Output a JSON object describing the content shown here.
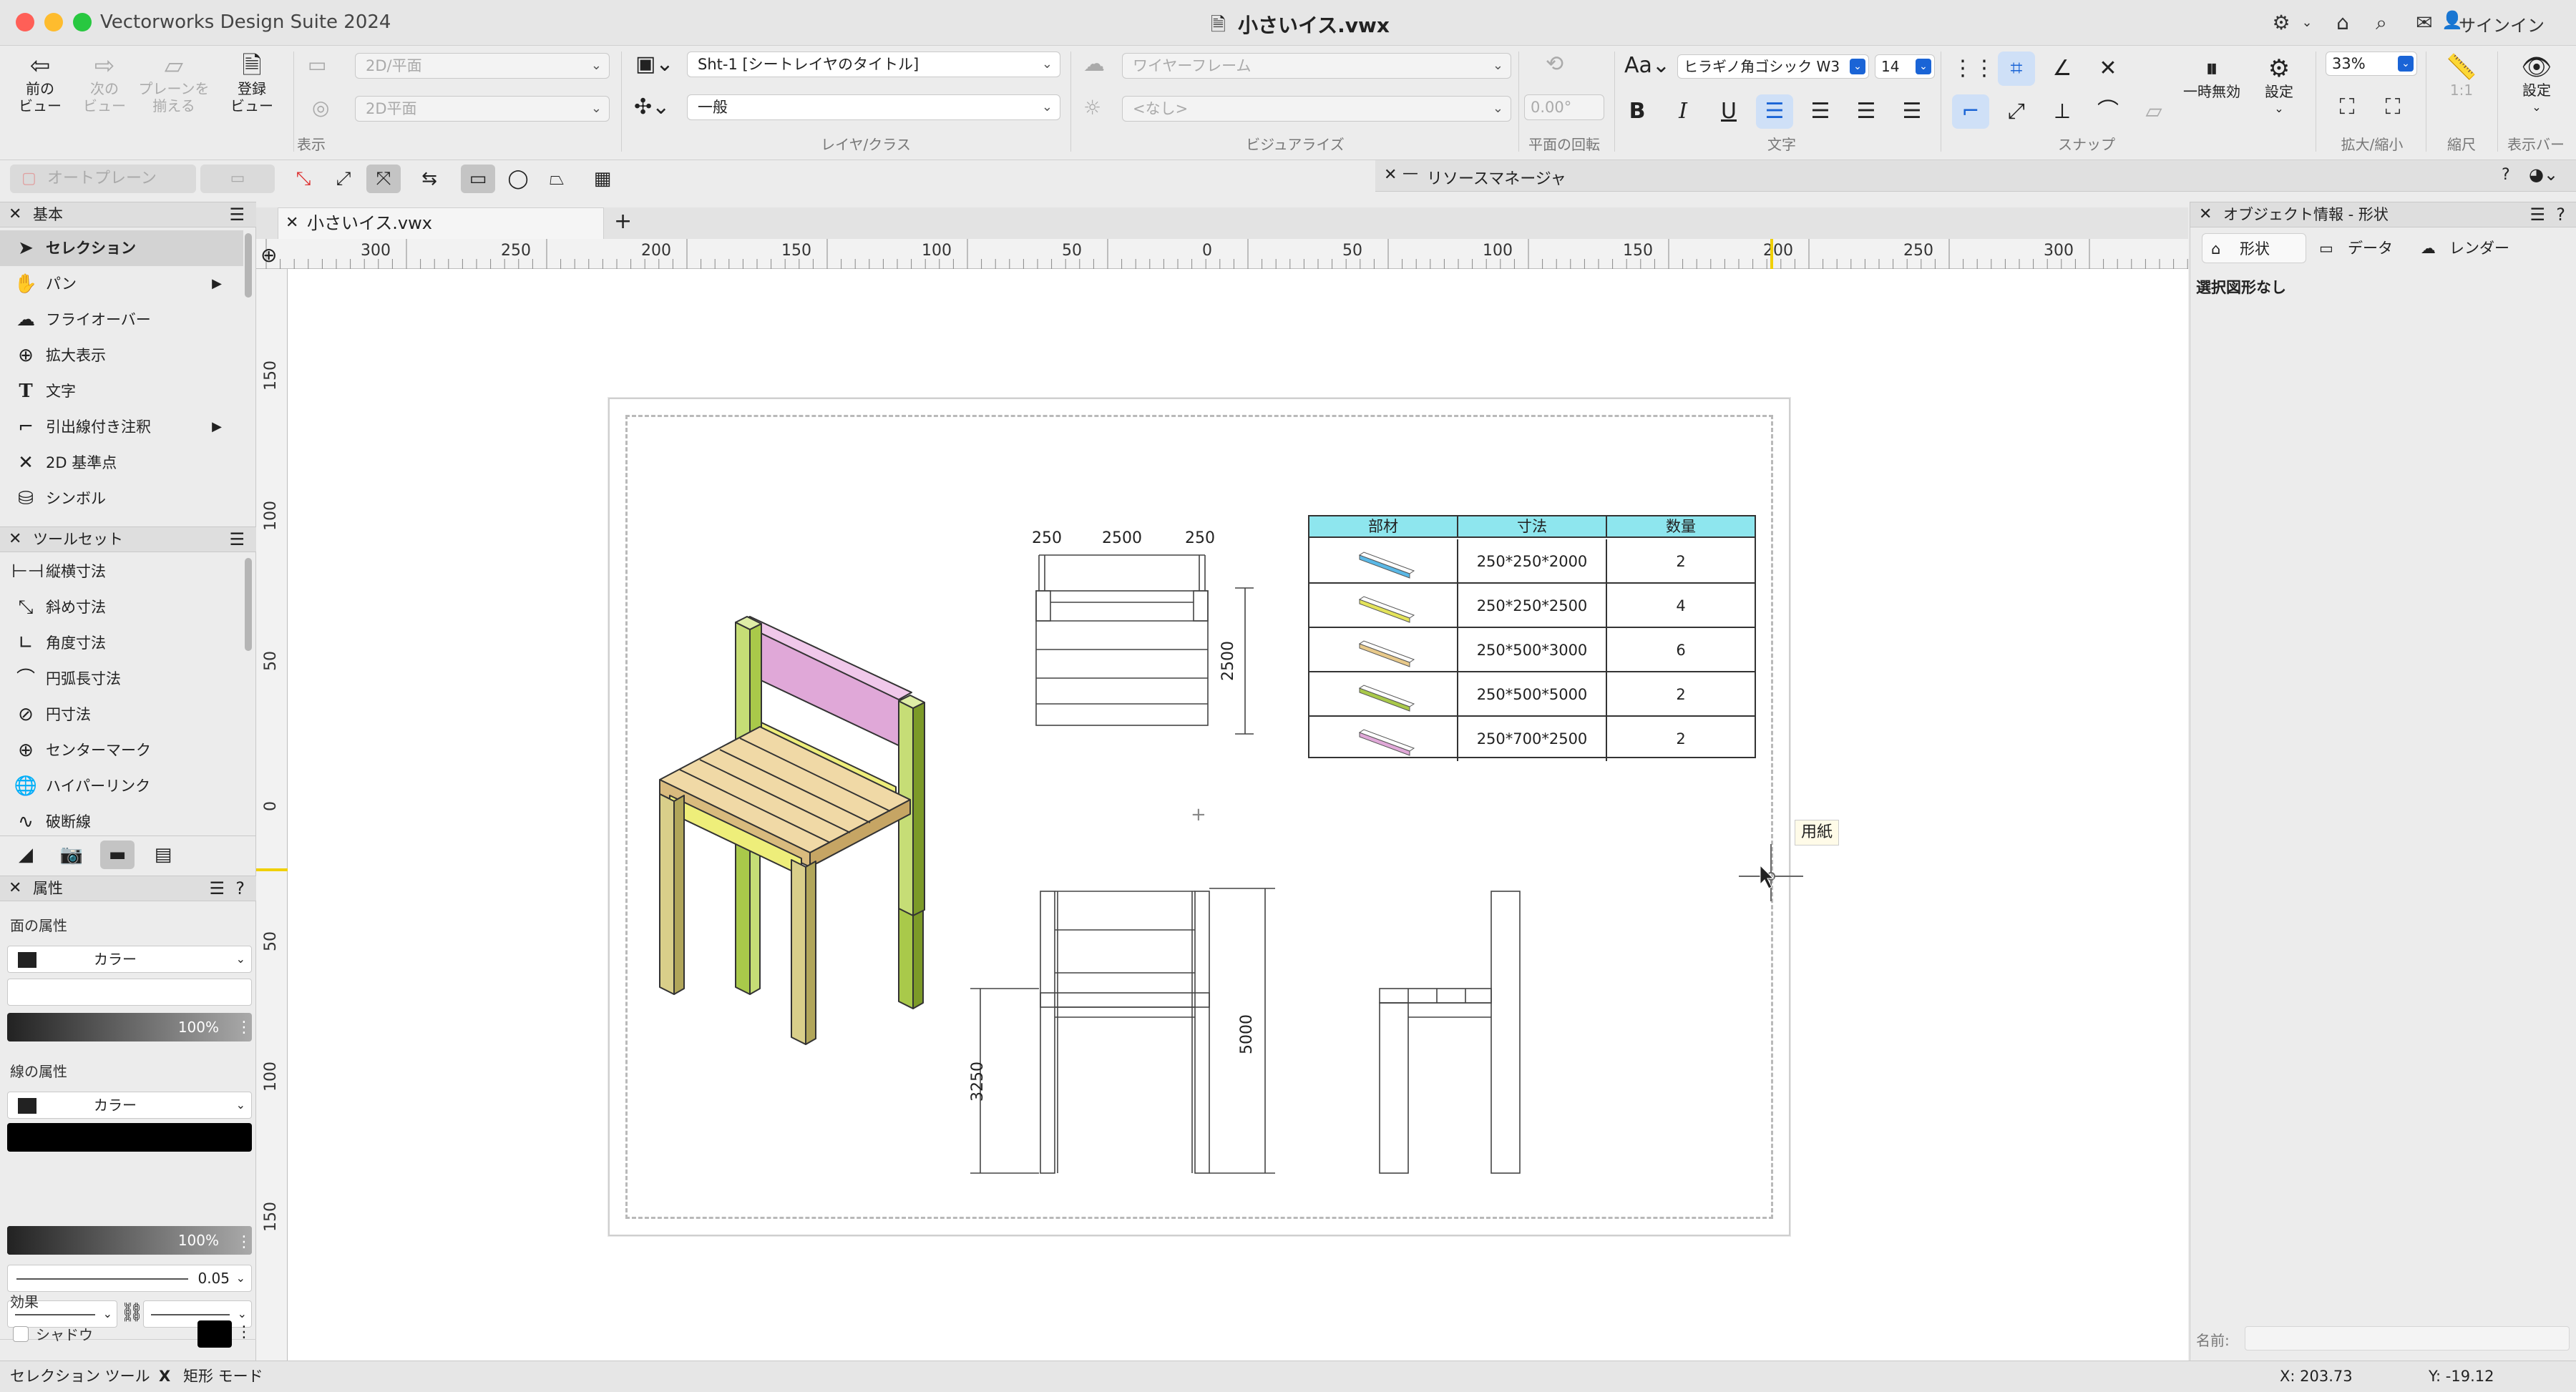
{
  "app": {
    "title": "Vectorworks Design Suite 2024",
    "document": "小さいイス.vwx",
    "signin": "サインイン"
  },
  "toolbar": {
    "prev_view": "前の\nビュー",
    "next_view": "次の\nビュー",
    "align_plane": "プレーンを\n揃える",
    "saved_view": "登録\nビュー",
    "view_dropdown_1": "2D/平面",
    "view_dropdown_2": "2D平面",
    "group_view": "表示",
    "layer_dropdown": "Sht-1 [シートレイヤのタイトル]",
    "class_dropdown": "一般",
    "group_layer_class": "レイヤ/クラス",
    "render_dropdown": "ワイヤーフレーム",
    "visualize_dropdown": "<なし>",
    "group_visualize": "ビジュアライズ",
    "rotation_value": "0.00°",
    "group_rotation": "平面の回転",
    "font_name": "ヒラギノ角ゴシック W3",
    "font_size": "14",
    "group_text": "文字",
    "group_snap": "スナップ",
    "suspend": "一時無効",
    "settings": "設定",
    "zoom_value": "33%",
    "group_zoom": "拡大/縮小",
    "scale_value": "1:1",
    "group_scale": "縮尺",
    "display_settings": "設定",
    "group_displaybar": "表示バー"
  },
  "modebar": {
    "auto_plane": "オートプレーン"
  },
  "resource_manager": {
    "title": "リソースマネージャ"
  },
  "basic_palette": {
    "title": "基本",
    "tools": [
      {
        "label": "セレクション"
      },
      {
        "label": "パン"
      },
      {
        "label": "フライオーバー"
      },
      {
        "label": "拡大表示"
      },
      {
        "label": "文字"
      },
      {
        "label": "引出線付き注釈"
      },
      {
        "label": "2D 基準点"
      },
      {
        "label": "シンボル"
      }
    ]
  },
  "toolset_palette": {
    "title": "ツールセット",
    "tools": [
      {
        "label": "縦横寸法"
      },
      {
        "label": "斜め寸法"
      },
      {
        "label": "角度寸法"
      },
      {
        "label": "円弧長寸法"
      },
      {
        "label": "円寸法"
      },
      {
        "label": "センターマーク"
      },
      {
        "label": "ハイパーリンク"
      },
      {
        "label": "破断線"
      }
    ]
  },
  "attributes": {
    "title": "属性",
    "fill_label": "面の属性",
    "fill_type": "カラー",
    "fill_opacity": "100%",
    "line_label": "線の属性",
    "line_type": "カラー",
    "line_opacity": "100%",
    "line_weight": "0.05",
    "effects_label": "効果",
    "shadow_label": "シャドウ"
  },
  "drawing": {
    "tab_label": "小さいイス.vwx",
    "h_ruler": [
      "300",
      "250",
      "200",
      "150",
      "100",
      "50",
      "0",
      "50",
      "100",
      "150",
      "200",
      "250",
      "300"
    ],
    "v_ruler": [
      "150",
      "100",
      "50",
      "0",
      "50",
      "100",
      "150"
    ],
    "paper_label": "用紙",
    "dims_top": {
      "a": "250",
      "b": "2500",
      "c": "250",
      "height": "2500"
    },
    "dims_front": {
      "height": "5000",
      "seat": "3250"
    },
    "bom": {
      "headers": [
        "部材",
        "寸法",
        "数量"
      ],
      "rows": [
        {
          "size": "250*250*2000",
          "qty": "2",
          "color": "#5ab8e6"
        },
        {
          "size": "250*250*2500",
          "qty": "4",
          "color": "#e3e35a"
        },
        {
          "size": "250*500*3000",
          "qty": "6",
          "color": "#e8c98a"
        },
        {
          "size": "250*500*5000",
          "qty": "2",
          "color": "#a9c94a"
        },
        {
          "size": "250*700*2500",
          "qty": "2",
          "color": "#e0a8d8"
        }
      ]
    }
  },
  "object_info": {
    "title": "オブジェクト情報 - 形状",
    "tabs": [
      "形状",
      "データ",
      "レンダー"
    ],
    "no_selection": "選択図形なし",
    "name_label": "名前:"
  },
  "status": {
    "tool": "セレクション ツール",
    "mode": "矩形 モード",
    "x": "X: 203.73",
    "y": "Y: -19.12"
  }
}
